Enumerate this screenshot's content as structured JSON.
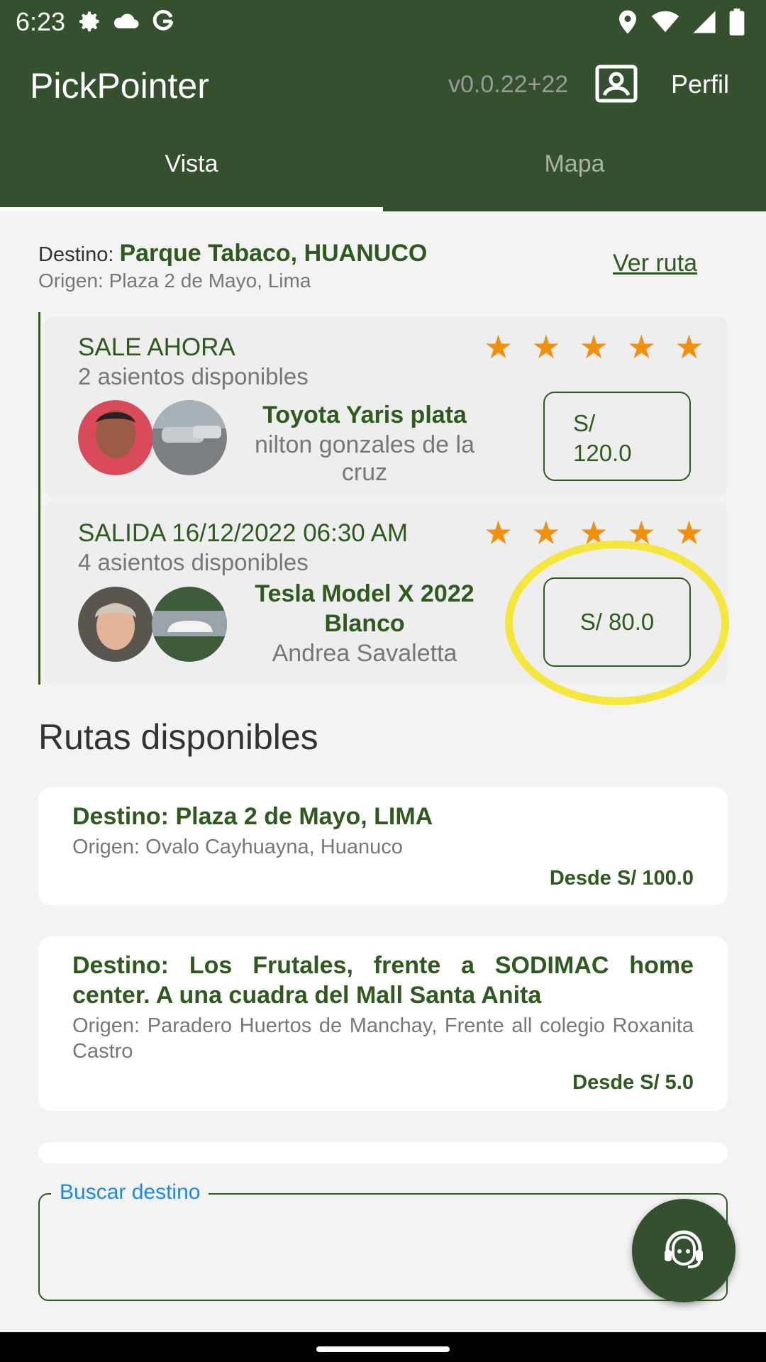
{
  "status": {
    "time": "6:23"
  },
  "appbar": {
    "title": "PickPointer",
    "version": "v0.0.22+22",
    "profile_label": "Perfil"
  },
  "tabs": [
    {
      "label": "Vista"
    },
    {
      "label": "Mapa"
    }
  ],
  "current_route": {
    "dest_prefix": "Destino: ",
    "dest": "Parque Tabaco, HUANUCO",
    "origin": "Origen: Plaza 2 de Mayo, Lima",
    "ver_ruta": "Ver ruta"
  },
  "trips": [
    {
      "when": "SALE AHORA",
      "seats": "2 asientos disponibles",
      "rating": 5,
      "car": "Toyota Yaris  plata",
      "driver": "nilton gonzales de la cruz",
      "price_line1": "S/",
      "price_line2": "120.0"
    },
    {
      "when": "SALIDA 16/12/2022 06:30 AM",
      "seats": "4 asientos disponibles",
      "rating": 5,
      "car_line1": "Tesla Model X 2022",
      "car_line2": "Blanco",
      "driver": "Andrea Savaletta",
      "price": "S/ 80.0"
    }
  ],
  "routes_title": "Rutas disponibles",
  "routes": [
    {
      "dest": "Destino: Plaza 2 de Mayo, LIMA",
      "origin": "Origen: Ovalo Cayhuayna, Huanuco",
      "price": "Desde S/ 100.0"
    },
    {
      "dest": "Destino: Los Frutales, frente a SODIMAC home center. A una cuadra del Mall Santa Anita",
      "origin": "Origen: Paradero Huertos de Manchay, Frente all colegio Roxanita Castro",
      "price": "Desde S/ 5.0"
    }
  ],
  "search": {
    "label": "Buscar destino"
  },
  "colors": {
    "primary": "#34502f",
    "accent_text": "#2f5a1f",
    "star": "#f18f0f",
    "highlight": "#f5e63d",
    "label_blue": "#1e88e5"
  }
}
